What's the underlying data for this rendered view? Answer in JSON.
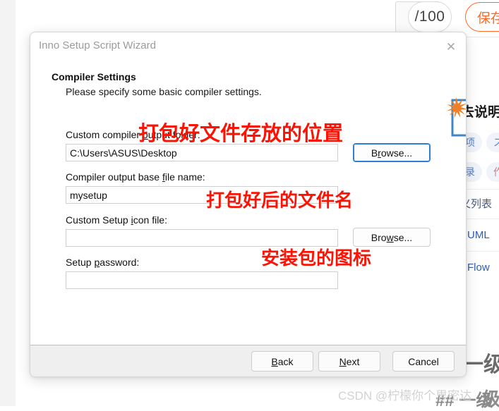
{
  "background": {
    "counter_text": "/100",
    "save_button_label": "保存",
    "right_column": {
      "heading": "去说明",
      "tags": [
        "项",
        "ス",
        "录",
        "作"
      ],
      "links": [
        "定义列表",
        "入UML",
        "入Flow"
      ],
      "big_text_1": "一级",
      "big_text_2": "级",
      "hash_marks": "## 一级"
    }
  },
  "watermark": {
    "text": "CSDN @柠檬你个思密达"
  },
  "dialog": {
    "title": "Inno Setup Script Wizard",
    "close_icon_label": "✕",
    "header": {
      "title": "Compiler Settings",
      "subtitle": "Please specify some basic compiler settings."
    },
    "page_icon_name": "wizard-page-icon",
    "fields": [
      {
        "id": "output-folder",
        "label_prefix": "Custom compiler ",
        "label_accel": "o",
        "label_suffix": "utput folder:",
        "value": "C:\\Users\\ASUS\\Desktop",
        "placeholder": "",
        "browse_label_prefix": "B",
        "browse_accel": "r",
        "browse_label_suffix": "owse...",
        "browse_focused": true
      },
      {
        "id": "base-file-name",
        "label_prefix": "Compiler output base ",
        "label_accel": "f",
        "label_suffix": "ile name:",
        "value": "mysetup",
        "placeholder": "",
        "has_browse": false
      },
      {
        "id": "setup-icon-file",
        "label_prefix": "Custom Setup ",
        "label_accel": "i",
        "label_suffix": "con file:",
        "value": "",
        "placeholder": "",
        "browse_label_prefix": "Bro",
        "browse_accel": "w",
        "browse_label_suffix": "se...",
        "browse_focused": false
      },
      {
        "id": "setup-password",
        "label_prefix": "Setup ",
        "label_accel": "p",
        "label_suffix": "assword:",
        "value": "",
        "placeholder": "",
        "has_browse": false
      }
    ],
    "footer": {
      "back": {
        "prefix": "",
        "accel": "B",
        "suffix": "ack"
      },
      "next": {
        "prefix": "",
        "accel": "N",
        "suffix": "ext"
      },
      "cancel": {
        "prefix": "Cancel",
        "accel": "",
        "suffix": ""
      }
    }
  },
  "annotations": {
    "output_folder": "打包好文件存放的位置",
    "file_name": "打包好后的文件名",
    "setup_icon": "安装包的图标"
  },
  "colors": {
    "annotation_red": "#fb1405",
    "accent_orange": "#ff6a2a",
    "focus_blue": "#2f7fd1",
    "doc_icon_blue": "#3d87c8",
    "watermark_gray": "#d2d2d2"
  }
}
